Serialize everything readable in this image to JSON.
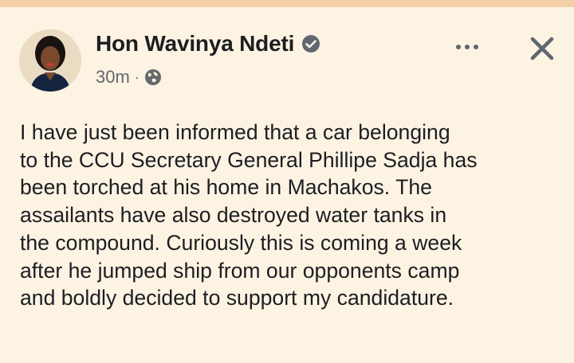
{
  "post": {
    "author_name": "Hon Wavinya Ndeti",
    "time_ago": "30m",
    "separator": "·",
    "privacy_icon": "globe-icon",
    "verified_icon": "verified-badge-icon",
    "text_lines": [
      "I have just been informed that a car belonging",
      "to the CCU Secretary General Phillipe Sadja has",
      "been torched at his home in Machakos. The",
      "assailants have also destroyed water tanks in",
      "the compound. Curiously this is coming a week",
      "after he jumped ship from our opponents camp",
      "and boldly decided to support my candidature."
    ]
  },
  "actions": {
    "more_icon": "more-horizontal-icon",
    "close_icon": "close-icon"
  },
  "colors": {
    "background": "#fdf3e3",
    "top_strip": "#f2cfa6",
    "text": "#1c1e21",
    "secondary_text": "#65676b",
    "verified_badge": "#606770"
  }
}
